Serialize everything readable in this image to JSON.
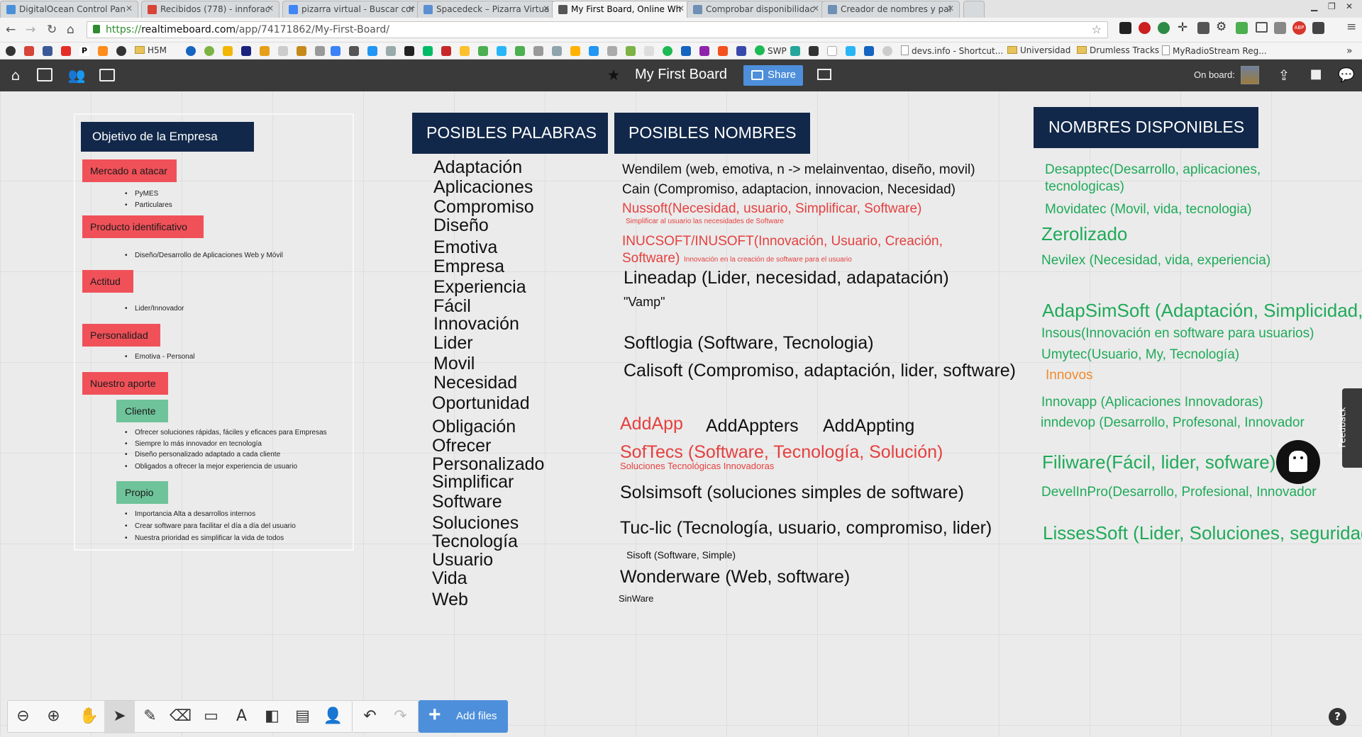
{
  "browser": {
    "tabs": [
      {
        "label": "DigitalOcean Control Pan",
        "active": false
      },
      {
        "label": "Recibidos (778) - innforac",
        "active": false
      },
      {
        "label": "pizarra virtual - Buscar cor",
        "active": false
      },
      {
        "label": "Spacedeck – Pizarra Virtua",
        "active": false
      },
      {
        "label": "My First Board, Online Wh",
        "active": true
      },
      {
        "label": "Comprobar disponibilidac",
        "active": false
      },
      {
        "label": "Creador de nombres y pal",
        "active": false
      }
    ],
    "url_scheme": "https://",
    "url_host": "realtimeboard.com",
    "url_path": "/app/74171862/My-First-Board/",
    "bookmarks": {
      "h5m": "H5M",
      "swp": "SWP",
      "devs": "devs.info - Shortcut...",
      "universidad": "Universidad",
      "drumless": "Drumless Tracks",
      "myradio": "MyRadioStream Reg..."
    }
  },
  "app": {
    "board_title": "My First Board",
    "share_label": "Share",
    "on_board_label": "On board:",
    "add_files_label": "Add files",
    "feedback_label": "Feedback",
    "help_label": "?"
  },
  "left_panel": {
    "title": "Objetivo de la Empresa",
    "sections": {
      "mercado": {
        "label": "Mercado a atacar",
        "bullets": [
          "PyMES",
          "Particulares"
        ]
      },
      "producto": {
        "label": "Producto identificativo",
        "bullets": [
          "Diseño/Desarrollo de Aplicaciones Web y Móvil"
        ]
      },
      "actitud": {
        "label": "Actitud",
        "bullets": [
          "Lider/Innovador"
        ]
      },
      "personalidad": {
        "label": "Personalidad",
        "bullets": [
          "Emotiva - Personal"
        ]
      },
      "aporte": {
        "label": "Nuestro aporte"
      }
    },
    "cliente": {
      "label": "Cliente",
      "bullets": [
        "Ofrecer soluciones rápidas, fáciles y eficaces para Empresas",
        "Siempre lo más innovador en tecnología",
        "Diseño personalizado adaptado a cada cliente",
        "Obligados a ofrecer la mejor experiencia de usuario"
      ]
    },
    "propio": {
      "label": "Propio",
      "bullets": [
        "Importancia Alta a desarrollos internos",
        "Crear software para facilitar el día a día del usuario",
        "Nuestra prioridad es simplificar la vida de todos"
      ]
    }
  },
  "palabras": {
    "header": "POSIBLES PALABRAS",
    "words": [
      "Adaptación",
      "Aplicaciones",
      "Compromiso",
      "Diseño",
      "Emotiva",
      "Empresa",
      "Experiencia",
      "Fácil",
      "Innovación",
      "Lider",
      "Movil",
      "Necesidad",
      "Oportunidad",
      "Obligación",
      "Ofrecer",
      "Personalizado",
      "Simplificar",
      "Software",
      "Soluciones",
      "Tecnología",
      "Usuario",
      "Vida",
      "Web"
    ]
  },
  "nombres": {
    "header": "POSIBLES NOMBRES",
    "items": {
      "wendilem": "Wendilem (web, emotiva, n -> melainventao, diseño, movil)",
      "cain": "Cain (Compromiso, adaptacion, innovacion, Necesidad)",
      "nussoft": "Nussoft(Necesidad, usuario, Simplificar, Software)",
      "nussoft_sub": "Simplificar al usuario las necesidades de Software",
      "inucsoft1": "INUCSOFT/INUSOFT(Innovación, Usuario, Creación,",
      "inucsoft2": "Software)",
      "inucsoft_sub": "Innovación en la creación de software para el usuario",
      "lineadap": "Lineadap (Lider, necesidad, adapatación)",
      "vamp": "\"Vamp\"",
      "softlogia": "Softlogia (Software,  Tecnologia)",
      "calisoft": "Calisoft (Compromiso, adaptación, lider, software)",
      "addapp": "AddApp",
      "addappters": "AddAppters",
      "addappting": "AddAppting",
      "softecs": "SofTecs (Software, Tecnología, Solución)",
      "softecs_sub": "Soluciones Tecnológicas Innovadoras",
      "solsimsoft": "Solsimsoft (soluciones simples de software)",
      "tuclic": "Tuc-lic (Tecnología, usuario, compromiso, lider)",
      "sisoft": "Sisoft  (Software, Simple)",
      "wonderware": "Wonderware (Web, software)",
      "sinware": "SinWare"
    }
  },
  "disponibles": {
    "header": "NOMBRES DISPONIBLES",
    "items": {
      "desapptec1": "Desapptec(Desarrollo, aplicaciones,",
      "desapptec2": "tecnologicas)",
      "movidatec": "Movidatec (Movil, vida, tecnologia)",
      "zerolizado": "Zerolizado",
      "nevilex": "Nevilex (Necesidad, vida, experiencia)",
      "adapsimsoft": "AdapSimSoft (Adaptación,  Simplicidad,",
      "insous": "Insous(Innovación en software para usuarios)",
      "umytec": "Umytec(Usuario, My, Tecnología)",
      "innovos": "Innovos",
      "innovapp": "Innovapp  (Aplicaciones Innovadoras)",
      "inndevop": "inndevop (Desarrollo, Profesonal, Innovador",
      "filiware": "Filiware(Fácil, lider, sofware)",
      "develinpro": "DevelInPro(Desarrollo, Profesional, Innovador",
      "lissessoft": "LissesSoft (Lider, Soluciones, seguridad,"
    }
  },
  "colors": {
    "navy": "#12284a",
    "section_red": "#f05159",
    "section_green": "#6fc39a",
    "accent_blue": "#4d8fdb",
    "name_red": "#e5403f",
    "name_green": "#1faa59",
    "name_orange": "#f08a2e"
  }
}
